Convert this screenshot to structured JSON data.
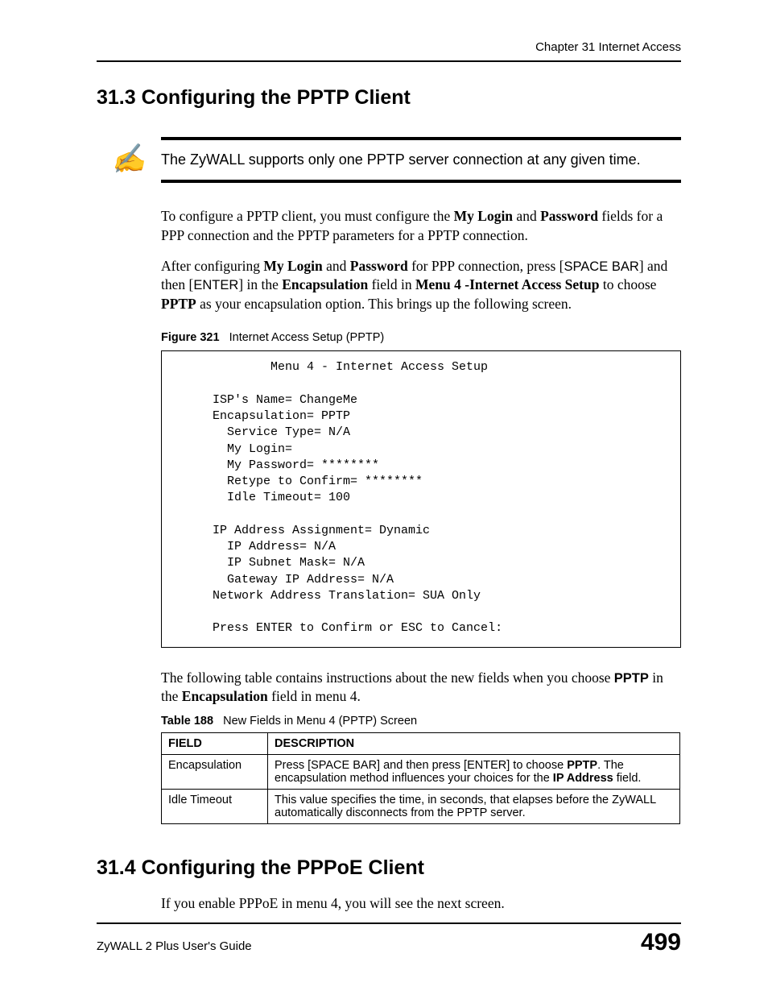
{
  "header": {
    "chapter_label": "Chapter 31 Internet Access"
  },
  "s1": {
    "heading": "31.3  Configuring the PPTP Client",
    "note": "The ZyWALL supports only one PPTP server connection at any given time.",
    "p1_a": "To configure a PPTP client, you must configure the ",
    "p1_b": "My Login",
    "p1_c": " and ",
    "p1_d": "Password",
    "p1_e": " fields for a PPP connection and the PPTP parameters for a PPTP connection.",
    "p2_a": "After configuring ",
    "p2_b": "My Login",
    "p2_c": " and ",
    "p2_d": "Password",
    "p2_e": " for PPP connection, press [",
    "p2_f": "SPACE BAR",
    "p2_g": "] and then [",
    "p2_h": "ENTER",
    "p2_i": "] in the ",
    "p2_j": "Encapsulation",
    "p2_k": " field in ",
    "p2_l": "Menu 4 -Internet Access Setup",
    "p2_m": " to choose ",
    "p2_n": "PPTP",
    "p2_o": " as your encapsulation option. This brings up the following screen.",
    "fig_label": "Figure 321",
    "fig_title": "Internet Access Setup (PPTP)",
    "screen": "             Menu 4 - Internet Access Setup\n\n     ISP's Name= ChangeMe\n     Encapsulation= PPTP\n       Service Type= N/A\n       My Login=\n       My Password= ********\n       Retype to Confirm= ********\n       Idle Timeout= 100\n\n     IP Address Assignment= Dynamic\n       IP Address= N/A\n       IP Subnet Mask= N/A\n       Gateway IP Address= N/A\n     Network Address Translation= SUA Only\n\n     Press ENTER to Confirm or ESC to Cancel:",
    "p3_a": "The following table contains instructions about the new fields when you choose ",
    "p3_b": "PPTP",
    "p3_c": " in the ",
    "p3_d": "Encapsulation",
    "p3_e": " field in menu 4.",
    "tbl_label": "Table 188",
    "tbl_title": "New Fields in Menu 4 (PPTP) Screen",
    "tbl": {
      "h1": "FIELD",
      "h2": "DESCRIPTION",
      "r1f": "Encapsulation",
      "r1d_a": "Press [SPACE BAR] and then press [ENTER] to choose ",
      "r1d_b": "PPTP",
      "r1d_c": ". The encapsulation method influences your choices for the ",
      "r1d_d": "IP Address",
      "r1d_e": " field.",
      "r2f": "Idle Timeout",
      "r2d": "This value specifies the time, in seconds, that elapses before the ZyWALL automatically disconnects from the PPTP server."
    }
  },
  "s2": {
    "heading": "31.4  Configuring the PPPoE Client",
    "p1": "If you enable PPPoE in menu 4, you will see the next screen."
  },
  "footer": {
    "guide": "ZyWALL 2 Plus User's Guide",
    "page": "499"
  }
}
